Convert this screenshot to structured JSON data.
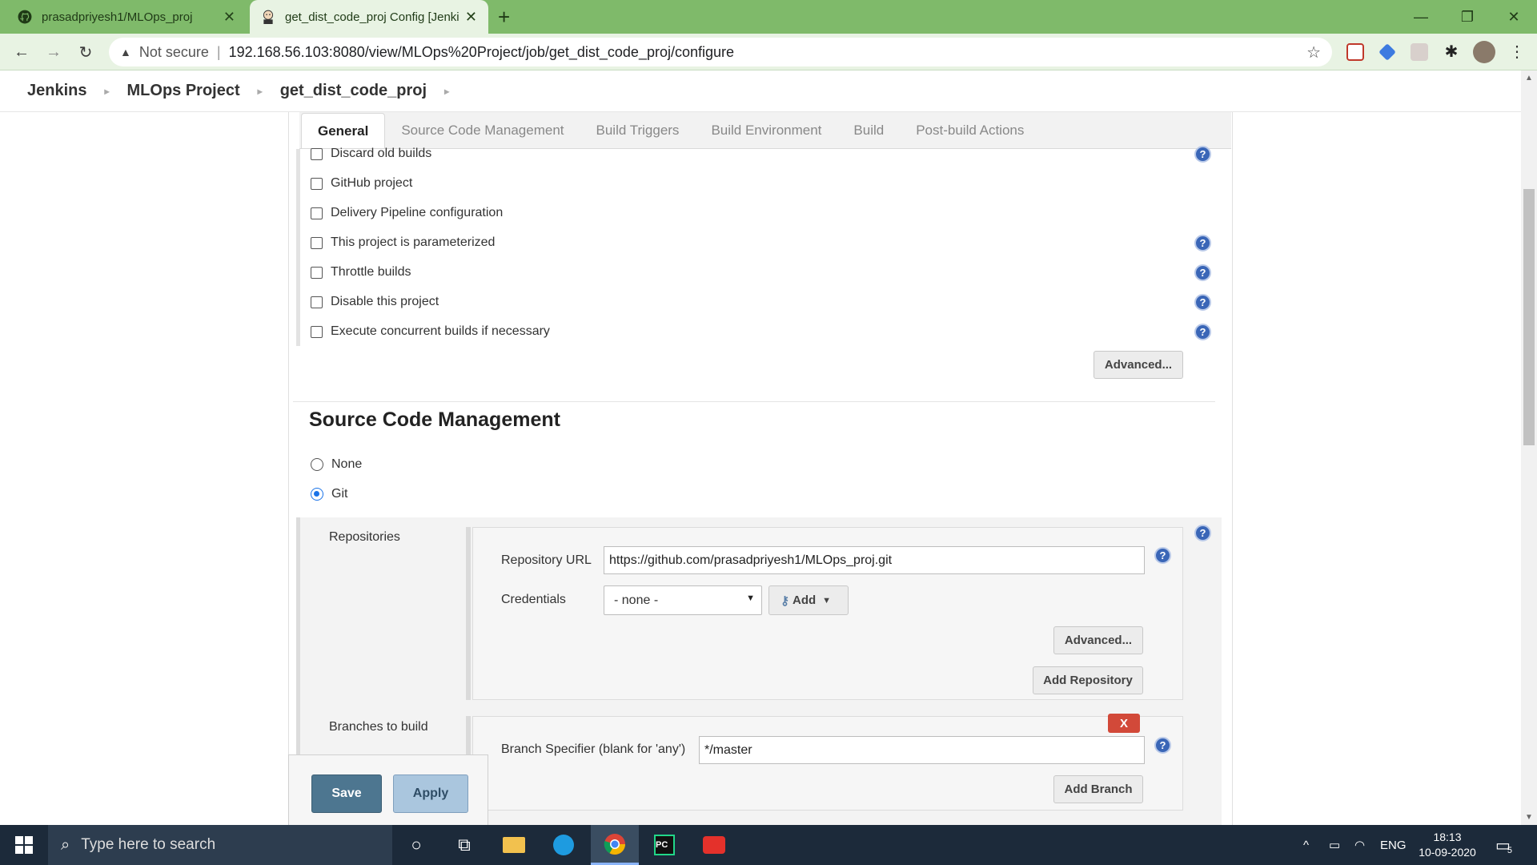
{
  "browser": {
    "tabs": [
      {
        "title": "prasadpriyesh1/MLOps_proj",
        "active": false,
        "icon": "github-icon"
      },
      {
        "title": "get_dist_code_proj Config [Jenkins]",
        "active": true,
        "icon": "jenkins-icon"
      }
    ],
    "new_tab": "+",
    "address": {
      "security_label": "Not secure",
      "url": "192.168.56.103:8080/view/MLOps%20Project/job/get_dist_code_proj/configure"
    }
  },
  "breadcrumb": {
    "items": [
      "Jenkins",
      "MLOps Project",
      "get_dist_code_proj"
    ]
  },
  "config_tabs": [
    "General",
    "Source Code Management",
    "Build Triggers",
    "Build Environment",
    "Build",
    "Post-build Actions"
  ],
  "general": {
    "options": [
      "Discard old builds",
      "GitHub project",
      "Delivery Pipeline configuration",
      "This project is parameterized",
      "Throttle builds",
      "Disable this project",
      "Execute concurrent builds if necessary"
    ],
    "advanced_label": "Advanced..."
  },
  "scm": {
    "title": "Source Code Management",
    "options": [
      "None",
      "Git"
    ],
    "selected": "Git",
    "repositories_label": "Repositories",
    "repository_url_label": "Repository URL",
    "repository_url_value": "https://github.com/prasadpriyesh1/MLOps_proj.git",
    "credentials_label": "Credentials",
    "credentials_value": "- none -",
    "add_label": "Add",
    "advanced_label": "Advanced...",
    "add_repository_label": "Add Repository",
    "branches_label": "Branches to build",
    "branch_specifier_label": "Branch Specifier (blank for 'any')",
    "branch_specifier_value": "*/master",
    "delete_label": "X",
    "add_branch_label": "Add Branch"
  },
  "actions": {
    "save_label": "Save",
    "apply_label": "Apply"
  },
  "help_glyph": "?",
  "taskbar": {
    "search_placeholder": "Type here to search",
    "language": "ENG",
    "time": "18:13",
    "date": "10-09-2020",
    "notification_count": "5"
  },
  "colors": {
    "chrome_frame": "#7fba6a",
    "save_button": "#4d7690",
    "delete_button": "#d24939",
    "help_icon": "#3a66b7"
  }
}
